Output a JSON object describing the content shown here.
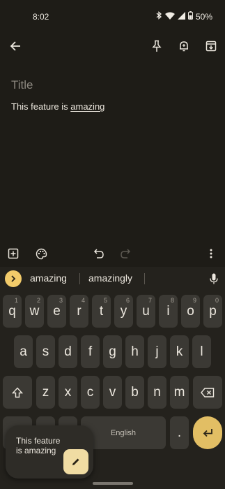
{
  "status": {
    "time": "8:02",
    "battery": "50%"
  },
  "note": {
    "title_placeholder": "Title",
    "body_prefix": "This feature is ",
    "body_underlined": "amazing"
  },
  "suggestions": [
    "amazing",
    "amazingly"
  ],
  "keyboard": {
    "row1": [
      {
        "k": "q",
        "h": "1"
      },
      {
        "k": "w",
        "h": "2"
      },
      {
        "k": "e",
        "h": "3"
      },
      {
        "k": "r",
        "h": "4"
      },
      {
        "k": "t",
        "h": "5"
      },
      {
        "k": "y",
        "h": "6"
      },
      {
        "k": "u",
        "h": "7"
      },
      {
        "k": "i",
        "h": "8"
      },
      {
        "k": "o",
        "h": "9"
      },
      {
        "k": "p",
        "h": "0"
      }
    ],
    "row2": [
      "a",
      "s",
      "d",
      "f",
      "g",
      "h",
      "j",
      "k",
      "l"
    ],
    "row3": [
      "z",
      "x",
      "c",
      "v",
      "b",
      "n",
      "m"
    ],
    "space_label": "English",
    "period": "."
  },
  "popup": {
    "text": "This feature is amazing"
  },
  "colors": {
    "background": "#1e1c17",
    "key": "#3b3934",
    "accent": "#e2be64",
    "suggest_toggle": "#f2cb6a"
  }
}
